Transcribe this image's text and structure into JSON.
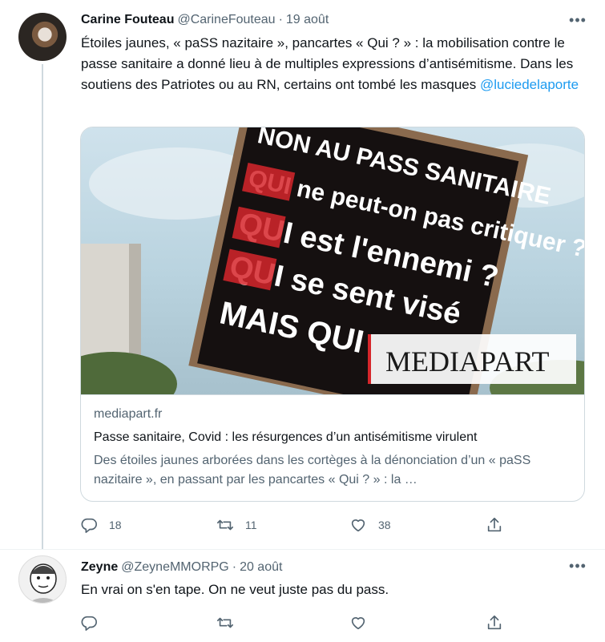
{
  "tweets": [
    {
      "author_name": "Carine Fouteau",
      "handle": "@CarineFouteau",
      "separator": "·",
      "date": "19 août",
      "more_icon": "more-horizontal-icon",
      "text_main": "Étoiles jaunes, « paSS nazitaire », pancartes « Qui ? » : la mobilisation contre le passe sanitaire a donné lieu à de multiples expressions d’antisémitisme. Dans les soutiens des Patriotes ou au RN, certains ont tombé les masques ",
      "mention": "@luciedelaporte",
      "card": {
        "image_sign_lines": [
          "NON AU PASS SANITAIRE",
          "QUI ne peut-on pas critiquer ?",
          "QUI est l'ennemi ?",
          "QUI se sent visé",
          "MAIS QUI"
        ],
        "image_watermark": "MEDIAPART",
        "domain": "mediapart.fr",
        "title": "Passe sanitaire, Covid : les résurgences d’un antisémitisme virulent",
        "description": "Des étoiles jaunes arborées dans les cortèges à la dénonciation d’un « paSS nazitaire », en passant par les pancartes « Qui ? » : la …"
      },
      "actions": {
        "reply_count": "18",
        "retweet_count": "11",
        "like_count": "38",
        "share_count": ""
      }
    },
    {
      "author_name": "Zeyne",
      "handle": "@ZeyneMMORPG",
      "separator": "·",
      "date": "20 août",
      "more_icon": "more-horizontal-icon",
      "text_main": "En vrai on s'en tape. On ne veut juste pas du pass.",
      "actions": {
        "reply_count": "",
        "retweet_count": "",
        "like_count": "",
        "share_count": ""
      }
    }
  ],
  "colors": {
    "text_primary": "#0f1419",
    "text_secondary": "#536471",
    "link": "#1d9bf0",
    "border": "#cfd9de",
    "sign_red": "#d6262b"
  }
}
